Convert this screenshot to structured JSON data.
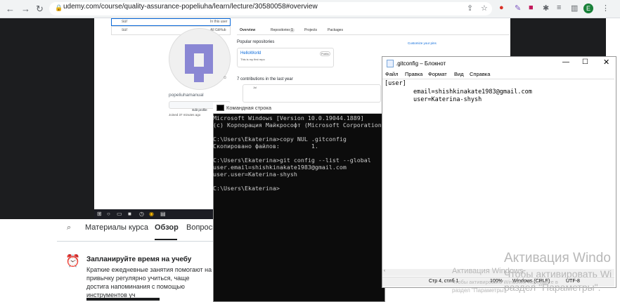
{
  "browser": {
    "url": "udemy.com/course/quality-assurance-popeliuha/learn/lecture/30580058#overview",
    "profile_initial": "E"
  },
  "github": {
    "search1": "sur",
    "search1_hint": "In this user",
    "search2": "sur",
    "search2_hint": "All GitHub",
    "tabs": [
      "Overview",
      "Repositories",
      "Projects",
      "Packages"
    ],
    "repos_count": "1",
    "popular_label": "Popular repositories",
    "customize": "Customize your pins",
    "repo_name": "HelloWorld",
    "repo_badge": "Public",
    "repo_desc": "This is my first repo",
    "contrib": "7 contributions in the last year",
    "username": "popeliuhamanual",
    "edit_profile": "Edit profile",
    "joined": "Joined 37 minutes ago",
    "month": "Jul"
  },
  "udemy": {
    "tabs": [
      "Материалы курса",
      "Обзор",
      "Вопрось"
    ],
    "active_tab": "Обзор",
    "reminder_title": "Запланируйте время на учебу",
    "reminder_text": "Краткие ежедневные занятия помогают на привычку регулярно учиться, чаще достига напоминания с помощью инструментов уч"
  },
  "cmd": {
    "title": "Командная строка",
    "lines": [
      "Microsoft Windows [Version 10.0.19044.1889]",
      "(c) Корпорация Майкрософт (Microsoft Corporation",
      "",
      "C:\\Users\\Ekaterina>copy NUL .gitconfig",
      "Скопировано файлов:         1.",
      "",
      "C:\\Users\\Ekaterina>git config --list --global",
      "user.email=shishkinakate1983@gmail.com",
      "user.user=Katerina-shysh",
      "",
      "C:\\Users\\Ekaterina>"
    ]
  },
  "notepad": {
    "title": ".gitconfig – Блокнот",
    "menu": [
      "Файл",
      "Правка",
      "Формат",
      "Вид",
      "Справка"
    ],
    "content": "[user]\n\temail=shishkinakate1983@gmail.com\n\tuser=Katerina-shysh",
    "status": {
      "position": "Стр 4, стлб 1",
      "zoom": "100%",
      "eol": "Windows (CRLF)",
      "encoding": "UTF-8"
    }
  },
  "watermark": {
    "title": "Активация Windo",
    "line1": "Чтобы активировать Wi",
    "line2": "раздел \"Параметры\".",
    "small_title": "Активация Windows",
    "small_line1": "Чтобы активировать Windows, перейдите в",
    "small_line2": "раздел \"Параметры\"."
  }
}
